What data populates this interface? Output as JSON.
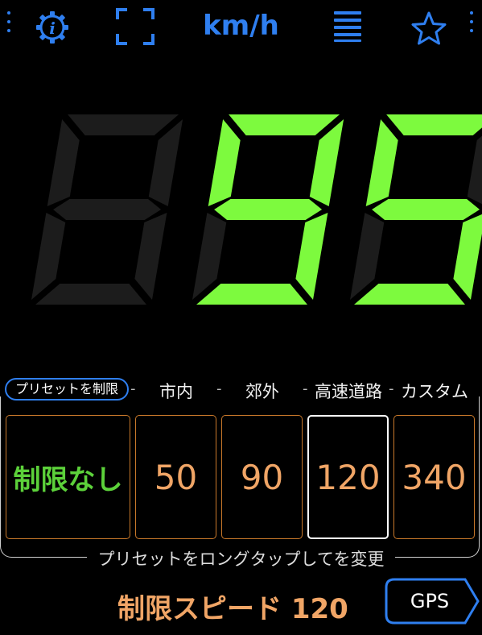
{
  "topbar": {
    "unit": "km/h",
    "icons": [
      "more-vertical-icon",
      "info-gear-icon",
      "fullscreen-icon",
      "menu-list-icon",
      "favorite-star-icon",
      "more-vertical-icon"
    ],
    "accent_color": "#2f7ff0"
  },
  "speed": {
    "value": "95",
    "digits": [
      "8",
      "9",
      "5"
    ],
    "lit": [
      false,
      true,
      true
    ],
    "lit_color": "#7dfa3e",
    "dim_color": "#1c1c1c"
  },
  "presets": {
    "edit_button": "プリセットを制限",
    "headers": [
      "市内",
      "郊外",
      "高速道路",
      "カスタム"
    ],
    "separator": "-",
    "cards": [
      {
        "label": "制限なし",
        "selected": false
      },
      {
        "label": "50",
        "selected": false
      },
      {
        "label": "90",
        "selected": false
      },
      {
        "label": "120",
        "selected": true
      },
      {
        "label": "340",
        "selected": false
      }
    ],
    "hint": "プリセットをロングタップしてを変更"
  },
  "status": {
    "limit_text": "制限スピード 120",
    "limit_color": "#f0a566",
    "gps_label": "GPS"
  }
}
